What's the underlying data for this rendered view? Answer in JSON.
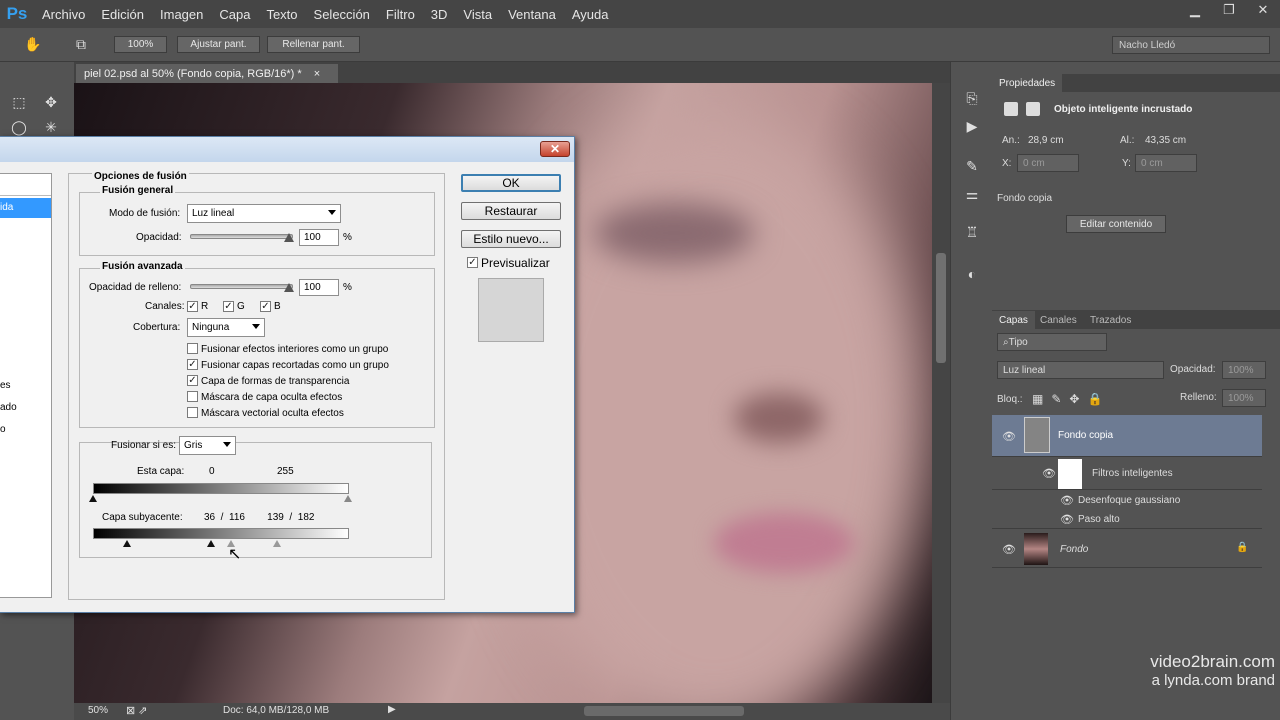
{
  "app": {
    "logo": "Ps"
  },
  "menu": [
    "Archivo",
    "Edición",
    "Imagen",
    "Capa",
    "Texto",
    "Selección",
    "Filtro",
    "3D",
    "Vista",
    "Ventana",
    "Ayuda"
  ],
  "window_controls": {
    "minimize": "▁",
    "restore": "❐",
    "close": "✕"
  },
  "options_bar": {
    "zoom_btn": "100%",
    "fit_btn": "Ajustar pant.",
    "fill_btn": "Rellenar pant.",
    "workspace": "Nacho Lledó"
  },
  "document": {
    "tab_title": "piel 02.psd al 50% (Fondo copia, RGB/16*) *",
    "close": "×"
  },
  "status": {
    "zoom": "50%",
    "doc": "Doc: 64,0 MB/128,0 MB"
  },
  "properties": {
    "tab": "Propiedades",
    "type": "Objeto inteligente incrustado",
    "an_label": "An.:",
    "an_value": "28,9 cm",
    "al_label": "Al.:",
    "al_value": "43,35 cm",
    "x_label": "X:",
    "x_placeholder": "0 cm",
    "y_label": "Y:",
    "y_placeholder": "0 cm",
    "layer_name": "Fondo copia",
    "edit_btn": "Editar contenido"
  },
  "layers_panel": {
    "tabs": [
      "Capas",
      "Canales",
      "Trazados"
    ],
    "filter": "Tipo",
    "blend_mode": "Luz lineal",
    "opacity_label": "Opacidad:",
    "opacity_value": "100%",
    "lock_label": "Bloq.:",
    "fill_label": "Relleno:",
    "fill_value": "100%",
    "layers": [
      {
        "name": "Fondo copia"
      },
      {
        "name": "Filtros inteligentes"
      },
      {
        "name": "Desenfoque gaussiano"
      },
      {
        "name": "Paso alto"
      },
      {
        "name": "Fondo"
      }
    ]
  },
  "dialog": {
    "close": "✕",
    "left_items": [
      "ida",
      "es",
      "ado",
      "o"
    ],
    "blend_options_title": "Opciones de fusión",
    "general_title": "Fusión general",
    "blend_mode_label": "Modo de fusión:",
    "blend_mode_value": "Luz lineal",
    "opacity_label": "Opacidad:",
    "opacity_value": "100",
    "percent": "%",
    "advanced_title": "Fusión avanzada",
    "fill_opacity_label": "Opacidad de relleno:",
    "fill_opacity_value": "100",
    "channels_label": "Canales:",
    "channel_r": "R",
    "channel_g": "G",
    "channel_b": "B",
    "knockout_label": "Cobertura:",
    "knockout_value": "Ninguna",
    "options": [
      {
        "label": "Fusionar efectos interiores como un grupo",
        "checked": false
      },
      {
        "label": "Fusionar capas recortadas como un grupo",
        "checked": true
      },
      {
        "label": "Capa de formas de transparencia",
        "checked": true
      },
      {
        "label": "Máscara de capa oculta efectos",
        "checked": false
      },
      {
        "label": "Máscara vectorial oculta efectos",
        "checked": false
      }
    ],
    "blend_if_label": "Fusionar si es:",
    "blend_if_value": "Gris",
    "this_layer_label": "Esta capa:",
    "this_layer_min": "0",
    "this_layer_max": "255",
    "underlying_label": "Capa subyacente:",
    "underlying_values": "36  /  116        139  /  182",
    "ok": "OK",
    "reset": "Restaurar",
    "new_style": "Estilo nuevo...",
    "preview": "Previsualizar"
  },
  "watermark": {
    "line1": "video2brain.com",
    "line2": "a lynda.com brand"
  }
}
